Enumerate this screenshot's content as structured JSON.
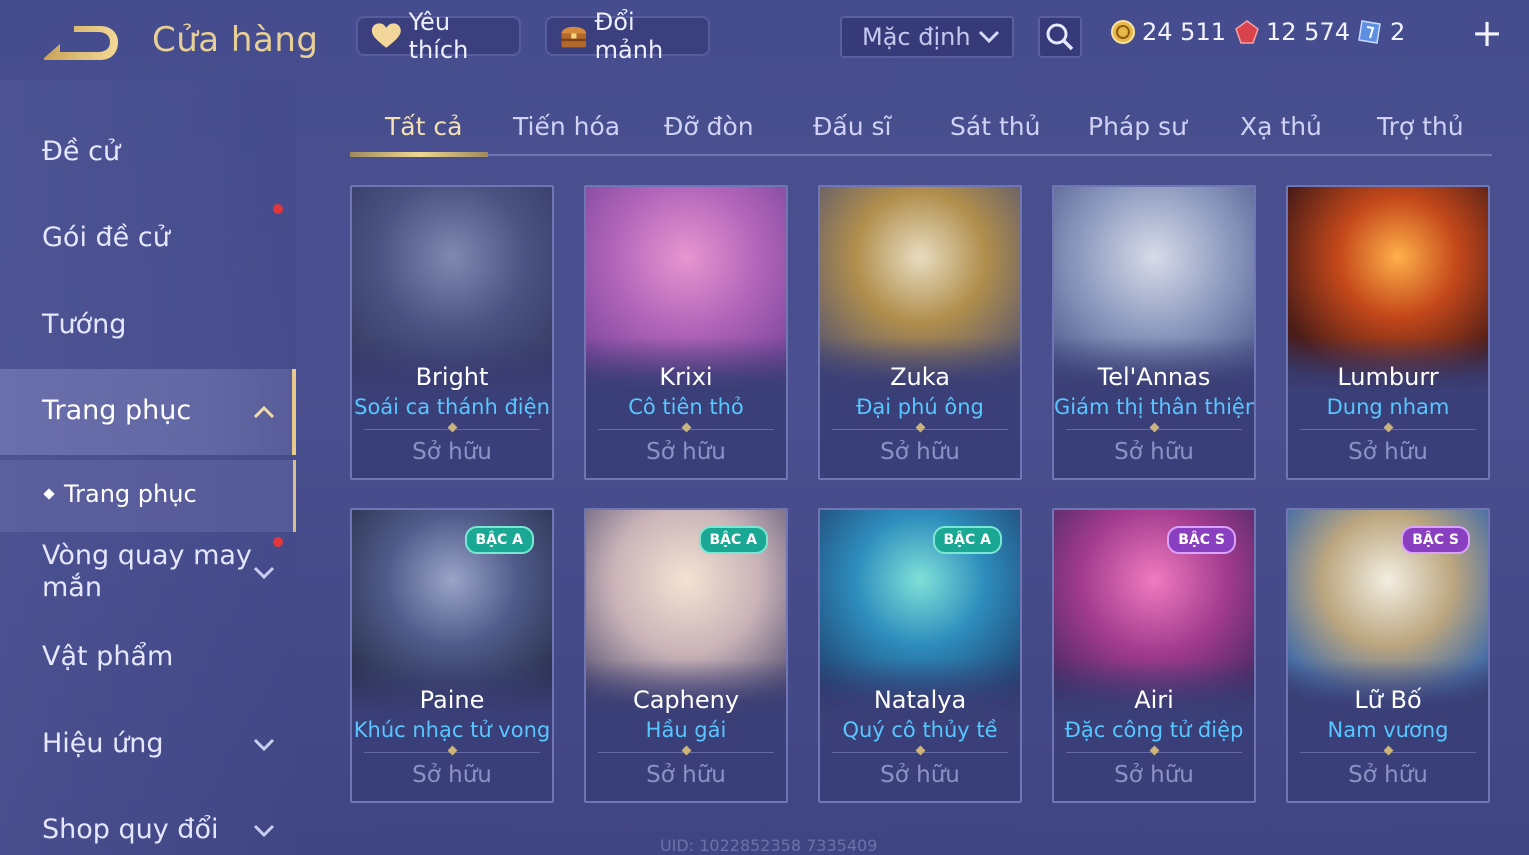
{
  "header": {
    "title": "Cửa hàng",
    "favorite_label": "Yêu thích",
    "shard_label": "Đổi mảnh",
    "sort_selected": "Mặc định",
    "currencies": {
      "gold": "24 511",
      "gems": "12 574",
      "tickets": "2"
    },
    "add_symbol": "+"
  },
  "sidebar": {
    "items": [
      {
        "label": "Đề cử"
      },
      {
        "label": "Gói đề cử"
      },
      {
        "label": "Tướng"
      },
      {
        "label": "Trang phục"
      },
      {
        "label": "Trang phục"
      },
      {
        "label": "Vòng quay may mắn"
      },
      {
        "label": "Vật phẩm"
      },
      {
        "label": "Hiệu ứng"
      },
      {
        "label": "Shop quy đổi"
      }
    ]
  },
  "tabs": [
    {
      "label": "Tất cả"
    },
    {
      "label": "Tiến hóa"
    },
    {
      "label": "Đỡ đòn"
    },
    {
      "label": "Đấu sĩ"
    },
    {
      "label": "Sát thủ"
    },
    {
      "label": "Pháp sư"
    },
    {
      "label": "Xạ thủ"
    },
    {
      "label": "Trợ thủ"
    }
  ],
  "cards": [
    {
      "hero": "Bright",
      "skin": "Soái ca thánh điện",
      "status": "Sở hữu",
      "badge": ""
    },
    {
      "hero": "Krixi",
      "skin": "Cô tiên thỏ",
      "status": "Sở hữu",
      "badge": ""
    },
    {
      "hero": "Zuka",
      "skin": "Đại phú ông",
      "status": "Sở hữu",
      "badge": ""
    },
    {
      "hero": "Tel'Annas",
      "skin": "Giám thị thân thiện",
      "status": "Sở hữu",
      "badge": ""
    },
    {
      "hero": "Lumburr",
      "skin": "Dung nham",
      "status": "Sở hữu",
      "badge": ""
    },
    {
      "hero": "Paine",
      "skin": "Khúc nhạc tử vong",
      "status": "Sở hữu",
      "badge": "BẬC A"
    },
    {
      "hero": "Capheny",
      "skin": "Hầu gái",
      "status": "Sở hữu",
      "badge": "BẬC A"
    },
    {
      "hero": "Natalya",
      "skin": "Quý cô thủy tề",
      "status": "Sở hữu",
      "badge": "BẬC A"
    },
    {
      "hero": "Airi",
      "skin": "Đặc công tử điệp",
      "status": "Sở hữu",
      "badge": "BẬC S"
    },
    {
      "hero": "Lữ Bố",
      "skin": "Nam vương",
      "status": "Sở hữu",
      "badge": "BẬC S"
    }
  ],
  "footer": {
    "uid": "UID: 1022852358 7335409"
  },
  "colors": {
    "accent_gold": "#e8cf96",
    "skin_name_blue": "#58c6ff",
    "notification_red": "#e0363c",
    "badge_a": "#1aa793",
    "badge_s": "#8a3ec0"
  }
}
